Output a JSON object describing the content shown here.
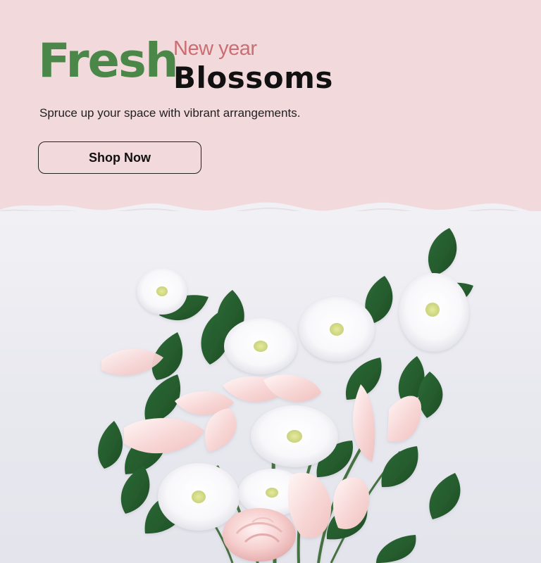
{
  "hero": {
    "headline_main": "Fresh",
    "headline_sub": "New year",
    "headline_accent": "Blossoms",
    "tagline": "Spruce up your space with vibrant arrangements.",
    "cta_label": "Shop Now"
  },
  "colors": {
    "top_background": "#f2d9dc",
    "photo_background": "#ecebf0",
    "headline_main": "#4b8748",
    "headline_sub": "#c96f73",
    "headline_accent": "#111111",
    "text": "#1f1f1f",
    "button_border": "#222222"
  },
  "icons": {
    "artwork": "floral-bouquet-icon"
  }
}
